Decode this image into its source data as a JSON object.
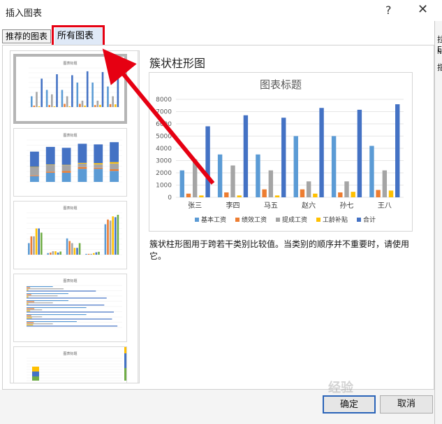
{
  "window": {
    "title": "插入图表",
    "help": "?",
    "close": "✕"
  },
  "tabs": {
    "recommended": "推荐的图表",
    "all": "所有图表"
  },
  "right_strip": [
    "拉",
    "E",
    "N",
    "指"
  ],
  "thumbnails": [
    {
      "title": "图表标题",
      "type": "clustered"
    },
    {
      "title": "图表标题",
      "type": "stacked"
    },
    {
      "title": "图表标题",
      "type": "clustered-by-series"
    },
    {
      "title": "图表标题",
      "type": "horizontal-bar"
    },
    {
      "title": "图表标题",
      "type": "stacked-single"
    }
  ],
  "preview": {
    "name": "簇状柱形图",
    "description": "簇状柱形图用于跨若干类别比较值。当类别的顺序并不重要时，请使用它。"
  },
  "chart_data": {
    "type": "bar",
    "title": "图表标题",
    "categories": [
      "张三",
      "李四",
      "马五",
      "赵六",
      "孙七",
      "王八"
    ],
    "series": [
      {
        "name": "基本工资",
        "color": "#5b9bd5",
        "values": [
          2200,
          3500,
          3500,
          5000,
          5000,
          4200
        ]
      },
      {
        "name": "绩效工资",
        "color": "#ed7d31",
        "values": [
          300,
          400,
          650,
          650,
          400,
          600
        ]
      },
      {
        "name": "提成工资",
        "color": "#a5a5a5",
        "values": [
          3100,
          2600,
          2200,
          1300,
          1300,
          2200
        ]
      },
      {
        "name": "工龄补贴",
        "color": "#ffc000",
        "values": [
          150,
          150,
          150,
          300,
          450,
          550
        ]
      },
      {
        "name": "合计",
        "color": "#4472c4",
        "values": [
          5800,
          6700,
          6500,
          7300,
          7150,
          7600
        ]
      }
    ],
    "y_ticks": [
      "0",
      "1000",
      "2000",
      "3000",
      "4000",
      "5000",
      "6000",
      "7000",
      "8000"
    ],
    "ylim": [
      0,
      8000
    ],
    "legend": "bottom",
    "grid": true
  },
  "buttons": {
    "ok": "确定",
    "cancel": "取消"
  },
  "watermark": "经验"
}
